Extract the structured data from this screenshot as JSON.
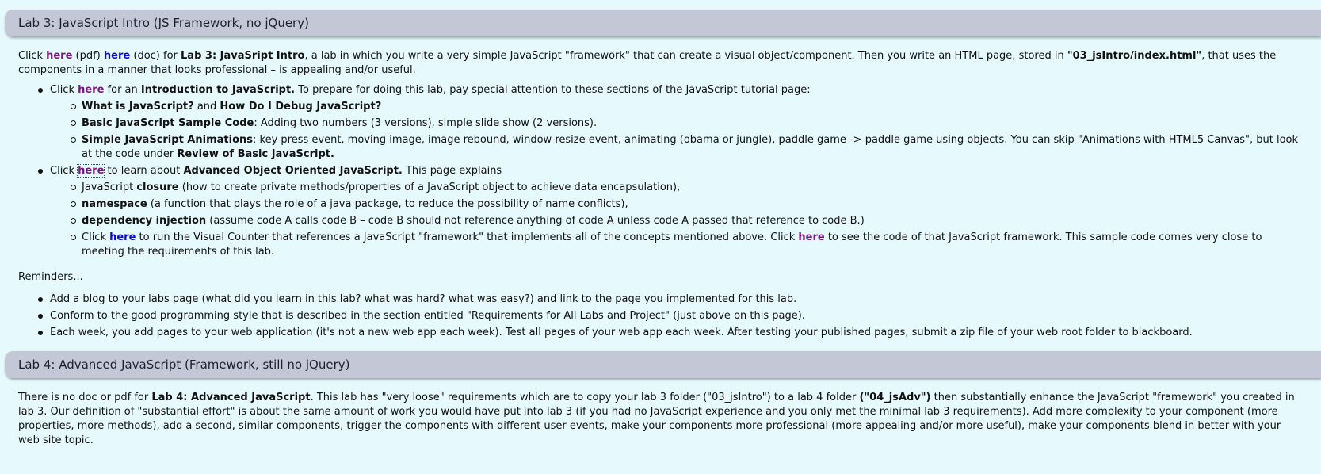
{
  "lab3": {
    "heading": "Lab 3: JavaScript Intro (JS Framework, no jQuery)",
    "intro": {
      "t1": "Click ",
      "link_pdf": "here",
      "t2": " (pdf) ",
      "link_doc": "here",
      "t3": " (doc) for ",
      "b1": "Lab 3: JavaSript Intro",
      "t4": ", a lab in which you write a very simple JavaScript \"framework\" that can create a visual object/component. Then you write an HTML page, stored in ",
      "b2": "\"03_jsIntro/index.html\"",
      "t5": ", that uses the components in a manner that looks professional – is appealing and/or useful."
    },
    "bullet1": {
      "t1": "Click ",
      "link": "here",
      "t2": " for an ",
      "b1": "Introduction to JavaScript.",
      "t3": " To prepare for doing this lab, pay special attention to these sections of the JavaScript tutorial page:",
      "sub": [
        {
          "b1": "What is JavaScript?",
          "t1": " and ",
          "b2": "How Do I Debug JavaScript?",
          "t2": ""
        },
        {
          "b1": "Basic JavaScript Sample Code",
          "t1": ": Adding two numbers (3 versions), simple slide show (2 versions).",
          "b2": "",
          "t2": ""
        },
        {
          "b1": "Simple JavaScript Animations",
          "t1": ": key press event, moving image, image rebound, window resize event, animating (obama or jungle), paddle game -> paddle game using objects. You can skip \"Animations with HTML5 Canvas\", but look at the code under ",
          "b2": "Review of Basic JavaScript.",
          "t2": ""
        }
      ]
    },
    "bullet2": {
      "t1": "Click ",
      "link": "here",
      "t2": " to learn about ",
      "b1": "Advanced Object Oriented JavaScript.",
      "t3": " This page explains",
      "sub1": {
        "t1": "JavaScript ",
        "b1": "closure",
        "t2": " (how to create private methods/properties of a JavaScript object to achieve data encapsulation),"
      },
      "sub2": {
        "b1": "namespace",
        "t1": " (a function that plays the role of a java package, to reduce the possibility of name conflicts),"
      },
      "sub3": {
        "b1": "dependency injection",
        "t1": " (assume code A calls code B – code B should not reference anything of code A unless code A passed that reference to code B.)"
      },
      "sub4": {
        "t1": "Click ",
        "link1": "here",
        "t2": " to run the Visual Counter that references a JavaScript \"framework\" that implements all of the concepts mentioned above. Click ",
        "link2": "here",
        "t3": " to see the code of that JavaScript framework. This sample code comes very close to meeting the requirements of this lab."
      }
    },
    "reminders_label": "Reminders...",
    "reminders": [
      "Add a blog to your labs page (what did you learn in this lab? what was hard? what was easy?) and link to the page you implemented for this lab.",
      "Conform to the good programming style that is described in the section entitled \"Requirements for All Labs and Project\" (just above on this page).",
      "Each week, you add pages to your web application (it's not a new web app each week). Test all pages of your web app each week. After testing your published pages, submit a zip file of your web root folder to blackboard."
    ]
  },
  "lab4": {
    "heading": "Lab 4: Advanced JavaScript (Framework, still no jQuery)",
    "intro": {
      "t1": "There is no doc or pdf for ",
      "b1": "Lab 4: Advanced JavaScript",
      "t2": ". This lab has \"very loose\" requirements which are to copy your lab 3 folder (\"03_jsIntro\") to a lab 4 folder ",
      "b2": "(\"04_jsAdv\")",
      "t3": " then substantially enhance the JavaScript \"framework\" you created in lab 3. Our definition of \"substantial effort\" is about the same amount of work you would have put into lab 3 (if you had no JavaScript experience and you only met the minimal lab 3 requirements). Add more complexity to your component (more properties, more methods), add a second, similar components, trigger the components with different user events, make your components more professional (more appealing and/or more useful), make your components blend in better with your web site topic."
    }
  },
  "colors": {
    "background": "#e6fafe",
    "header_bar": "#c4c7d6",
    "link_visited": "#7d1580",
    "link_unvisited": "#0a0ad0"
  }
}
